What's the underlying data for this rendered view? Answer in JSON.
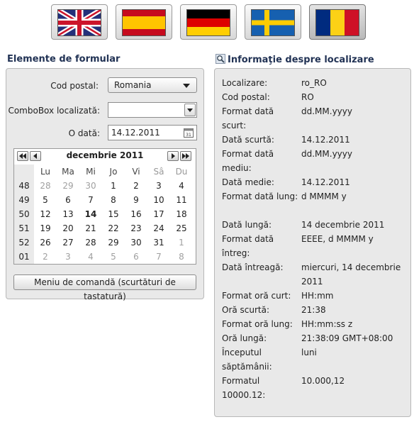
{
  "flags": [
    {
      "name": "uk-flag",
      "selected": false
    },
    {
      "name": "spain-flag",
      "selected": false
    },
    {
      "name": "germany-flag",
      "selected": false
    },
    {
      "name": "sweden-flag",
      "selected": false
    },
    {
      "name": "romania-flag",
      "selected": true
    }
  ],
  "form": {
    "title": "Elemente de formular",
    "postal_label": "Cod postal:",
    "postal_value": "Romania",
    "combo_label": "ComboBox localizată:",
    "combo_value": "",
    "date_label": "O dată:",
    "date_value": "14.12.2011",
    "menu_button": "Meniu de comandă (scurtături de tastatură)"
  },
  "calendar": {
    "month": "decembrie 2011",
    "weekdays": [
      "Lu",
      "Ma",
      "Mi",
      "Jo",
      "Vi",
      "Sâ",
      "Du"
    ],
    "weeks": [
      {
        "num": "48",
        "days": [
          {
            "d": "28",
            "o": true
          },
          {
            "d": "29",
            "o": true
          },
          {
            "d": "30",
            "o": true
          },
          {
            "d": "1"
          },
          {
            "d": "2"
          },
          {
            "d": "3"
          },
          {
            "d": "4"
          }
        ]
      },
      {
        "num": "49",
        "days": [
          {
            "d": "5"
          },
          {
            "d": "6"
          },
          {
            "d": "7"
          },
          {
            "d": "8"
          },
          {
            "d": "9"
          },
          {
            "d": "10"
          },
          {
            "d": "11"
          }
        ]
      },
      {
        "num": "50",
        "days": [
          {
            "d": "12"
          },
          {
            "d": "13"
          },
          {
            "d": "14",
            "t": true
          },
          {
            "d": "15"
          },
          {
            "d": "16"
          },
          {
            "d": "17"
          },
          {
            "d": "18"
          }
        ]
      },
      {
        "num": "51",
        "days": [
          {
            "d": "19"
          },
          {
            "d": "20"
          },
          {
            "d": "21"
          },
          {
            "d": "22"
          },
          {
            "d": "23"
          },
          {
            "d": "24"
          },
          {
            "d": "25"
          }
        ]
      },
      {
        "num": "52",
        "days": [
          {
            "d": "26"
          },
          {
            "d": "27"
          },
          {
            "d": "28"
          },
          {
            "d": "29"
          },
          {
            "d": "30"
          },
          {
            "d": "31"
          },
          {
            "d": "1",
            "o": true
          }
        ]
      },
      {
        "num": "01",
        "days": [
          {
            "d": "2",
            "o": true
          },
          {
            "d": "3",
            "o": true
          },
          {
            "d": "4",
            "o": true
          },
          {
            "d": "5",
            "o": true
          },
          {
            "d": "6",
            "o": true
          },
          {
            "d": "7",
            "o": true
          },
          {
            "d": "8",
            "o": true
          }
        ]
      }
    ]
  },
  "locale": {
    "title": "Informaţie despre localizare",
    "rows": [
      {
        "k": "Localizare:",
        "v": "ro_RO"
      },
      {
        "k": "Cod postal:",
        "v": "RO"
      },
      {
        "k": "Format dată scurt:",
        "v": "dd.MM.yyyy"
      },
      {
        "k": "Dată scurtă:",
        "v": "14.12.2011"
      },
      {
        "k": "Format dată mediu:",
        "v": "dd.MM.yyyy"
      },
      {
        "k": "Dată medie:",
        "v": "14.12.2011"
      },
      {
        "k": "Format dată lung:",
        "v": "d MMMM y"
      },
      {
        "k": "Dată lungă:",
        "v": "14 decembrie 2011"
      },
      {
        "k": "Format dată întreg:",
        "v": "EEEE, d MMMM y"
      },
      {
        "k": "Dată întreagă:",
        "v": "miercuri, 14 decembrie 2011"
      },
      {
        "k": "Format oră curt:",
        "v": "HH:mm"
      },
      {
        "k": "Oră scurtă:",
        "v": "21:38"
      },
      {
        "k": "Format oră lung:",
        "v": "HH:mm:ss z"
      },
      {
        "k": "Oră lungă:",
        "v": "21:38:09 GMT+08:00"
      },
      {
        "k": "Începutul săptămânii:",
        "v": "luni"
      },
      {
        "k": "Formatul 10000.12:",
        "v": "10.000,12"
      }
    ]
  }
}
